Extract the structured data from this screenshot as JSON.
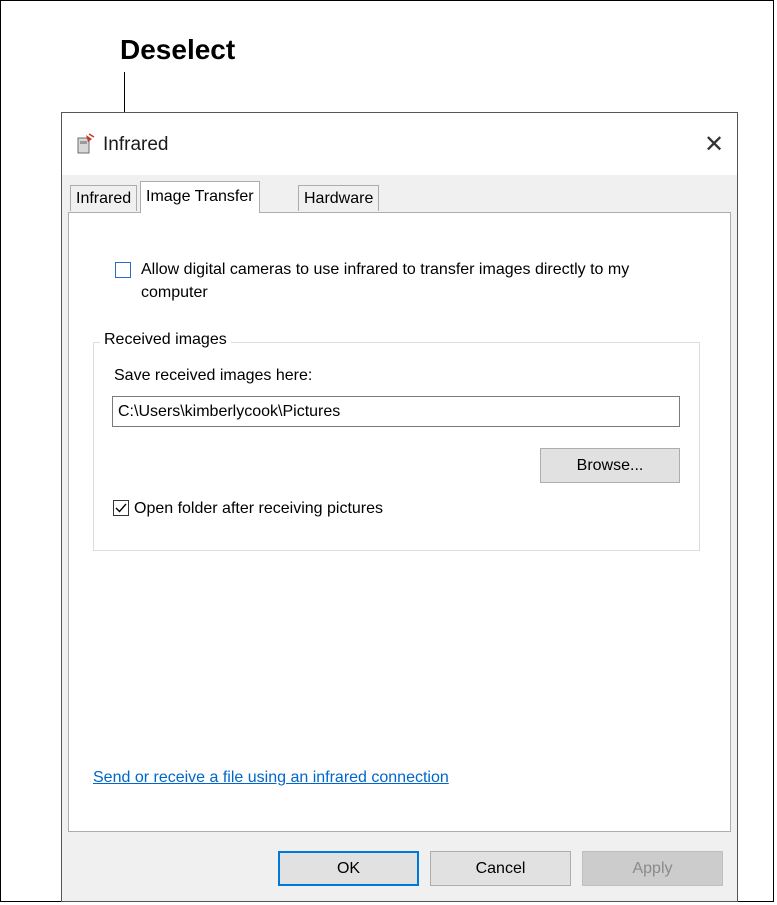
{
  "annotation": {
    "callout_text": "Deselect"
  },
  "dialog": {
    "title": "Infrared",
    "icon": "infrared-app-icon",
    "close_glyph": "✕",
    "tabs": [
      {
        "label": "Infrared",
        "active": false
      },
      {
        "label": "Image Transfer",
        "active": true
      },
      {
        "label": "Hardware",
        "active": false
      }
    ],
    "allow_cameras": {
      "label": "Allow digital cameras to use infrared to transfer images directly to my computer",
      "checked": false
    },
    "received_group": {
      "title": "Received images",
      "save_label": "Save received images here:",
      "path_value": "C:\\Users\\kimberlycook\\Pictures",
      "browse_label": "Browse...",
      "open_folder": {
        "label": "Open folder after receiving pictures",
        "checked": true
      }
    },
    "send_link": "Send or receive a file using an infrared connection",
    "buttons": {
      "ok": "OK",
      "cancel": "Cancel",
      "apply": "Apply"
    }
  },
  "colors": {
    "focus_blue": "#0078d7",
    "link_blue": "#0066cc",
    "dialog_bg": "#f0f0f0"
  }
}
